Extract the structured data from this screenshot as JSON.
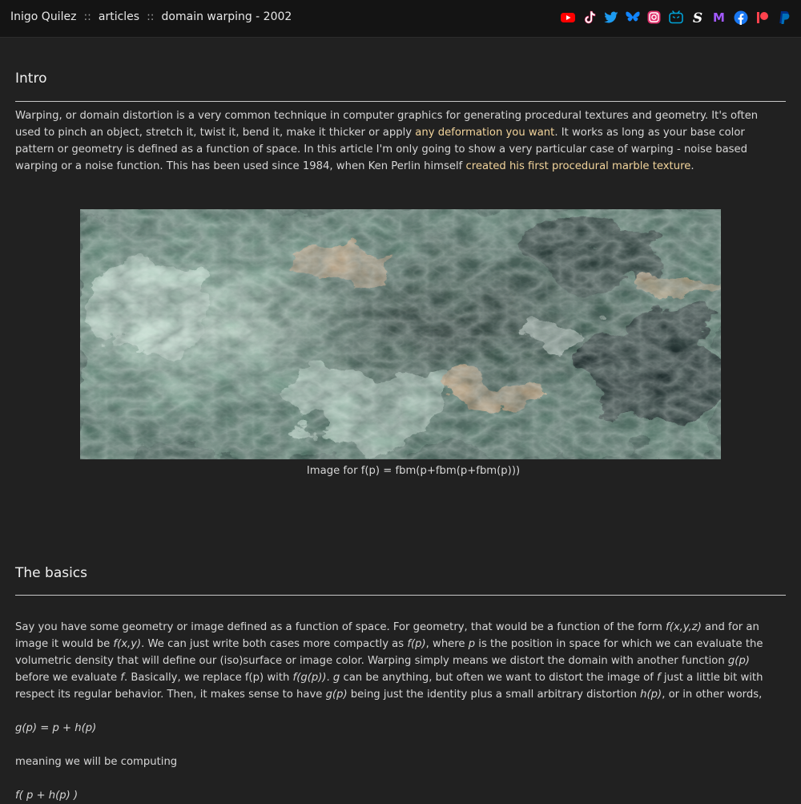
{
  "header": {
    "crumbs": [
      "Inigo Quilez",
      "articles",
      "domain warping - 2002"
    ],
    "separator": "::",
    "socials": [
      {
        "icon": "youtube-icon",
        "color": "#ff0000"
      },
      {
        "icon": "tiktok-icon",
        "color": "#ffffff"
      },
      {
        "icon": "twitter-icon",
        "color": "#1d9bf0"
      },
      {
        "icon": "bluesky-icon",
        "color": "#1185fe"
      },
      {
        "icon": "instagram-icon",
        "color": "#e1306c"
      },
      {
        "icon": "bilibili-icon",
        "color": "#00a1d6"
      },
      {
        "icon": "substack-icon",
        "color": "#ffffff"
      },
      {
        "icon": "medium-icon",
        "color": "#a259ff"
      },
      {
        "icon": "facebook-icon",
        "color": "#1877f2"
      },
      {
        "icon": "patreon-icon",
        "color": "#ff424d"
      },
      {
        "icon": "paypal-icon",
        "color": "#0070ba"
      }
    ]
  },
  "intro": {
    "heading": "Intro",
    "p1_a": "Warping, or domain distortion is a very common technique in computer graphics for generating procedural textures and geometry. It's often used to pinch an object, stretch it, twist it, bend it, make it thicker or apply ",
    "link1": "any deformation you want",
    "p1_b": ". It works as long as your base color pattern or geometry is defined as a function of space. In this article I'm only going to show a very particular case of warping - noise based warping or a noise function. This has been used since 1984, when Ken Perlin himself ",
    "link2": "created his first procedural marble texture",
    "p1_c": ".",
    "caption": "Image for f(p) = fbm(p+fbm(p+fbm(p)))"
  },
  "basics": {
    "heading": "The basics",
    "t1": "Say you have some geometry or image defined as a function of space. For geometry, that would be a function of the form ",
    "e1": "f(x,y,z)",
    "t2": " and for an image it would be ",
    "e2": "f(x,y)",
    "t3": ". We can just write both cases more compactly as ",
    "e3": "f(p)",
    "t4": ", where ",
    "e4": "p",
    "t5": " is the position in space for which we can evaluate the volumetric density that will define our (iso)surface or image color. Warping simply means we distort the domain with another function ",
    "e5": "g(p)",
    "t6": " before we evaluate ",
    "e6": "f",
    "t7": ". Basically, we replace f(p) with ",
    "e7": "f(g(p))",
    "t8": ". ",
    "e8": "g",
    "t9": " can be anything, but often we want to distort the image of ",
    "e9": "f",
    "t10": " just a little bit with respect its regular behavior. Then, it makes sense to have ",
    "e10": "g(p)",
    "t11": " being just the identity plus a small arbitrary distortion ",
    "e11": "h(p)",
    "t12": ", or in other words,",
    "formula1": "g(p) = p + h(p)",
    "p3": "meaning we will be computing",
    "formula2": "f( p + h(p) )"
  }
}
